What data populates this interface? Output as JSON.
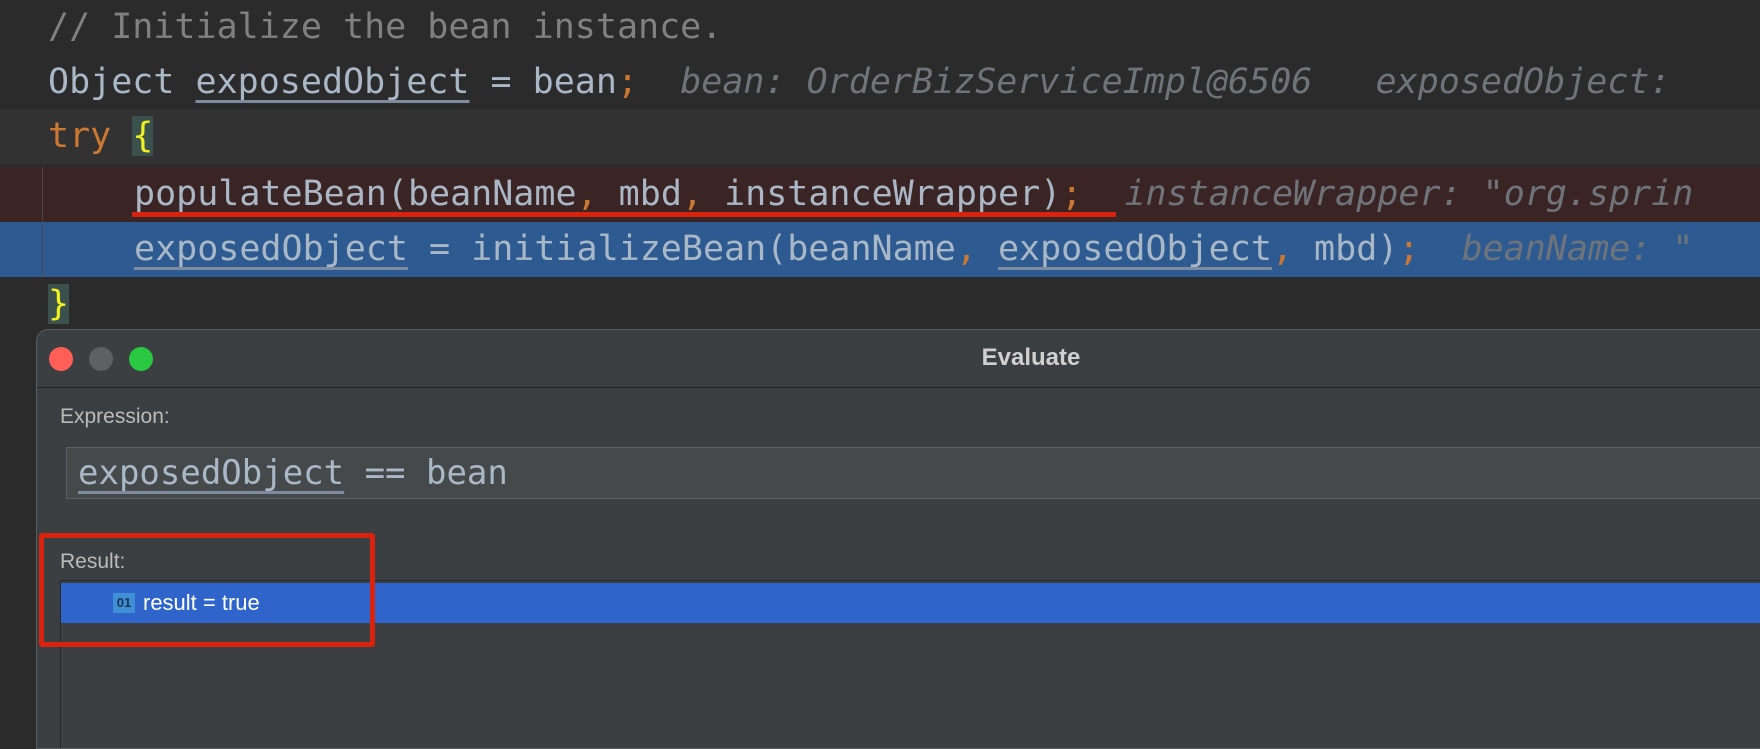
{
  "editor": {
    "lines": [
      {
        "id": "row-comment",
        "indent": 0,
        "tokens": [
          {
            "t": "// Initialize the bean instance.",
            "c": "t-cm"
          }
        ]
      },
      {
        "id": "row-obj",
        "indent": 0,
        "tokens": [
          {
            "t": "Object ",
            "c": ""
          },
          {
            "t": "exposedObject",
            "c": "t-u"
          },
          {
            "t": " = bean",
            "c": ""
          },
          {
            "t": ";",
            "c": "t-punc"
          },
          {
            "t": "  bean: OrderBizServiceImpl@6506   exposedObject:",
            "c": "t-hint"
          }
        ]
      },
      {
        "id": "row-try",
        "indent": 0,
        "tokens": [
          {
            "t": "try",
            "c": "t-kw"
          },
          {
            "t": " ",
            "c": ""
          },
          {
            "t": "{",
            "c": "t-br"
          }
        ]
      },
      {
        "id": "row-pop",
        "indent": 1,
        "tokens": [
          {
            "t": "populateBean",
            "c": ""
          },
          {
            "t": "(beanName",
            "c": ""
          },
          {
            "t": ",",
            "c": "t-punc"
          },
          {
            "t": " mbd",
            "c": ""
          },
          {
            "t": ",",
            "c": "t-punc"
          },
          {
            "t": " ",
            "c": ""
          },
          {
            "t": "instanceWrapper",
            "c": "t-u"
          },
          {
            "t": ")",
            "c": ""
          },
          {
            "t": ";",
            "c": "t-punc"
          },
          {
            "t": "  instanceWrapper: \"org.sprin",
            "c": "t-hint"
          }
        ]
      },
      {
        "id": "row-exp",
        "indent": 1,
        "tokens": [
          {
            "t": "exposedObject",
            "c": "t-u"
          },
          {
            "t": " = initializeBean(beanName",
            "c": ""
          },
          {
            "t": ",",
            "c": "t-punc"
          },
          {
            "t": " ",
            "c": ""
          },
          {
            "t": "exposedObject",
            "c": "t-u"
          },
          {
            "t": ",",
            "c": "t-punc"
          },
          {
            "t": " mbd)",
            "c": ""
          },
          {
            "t": ";",
            "c": "t-punc"
          },
          {
            "t": "  beanName: \"",
            "c": "t-hint"
          }
        ]
      },
      {
        "id": "row-brace",
        "indent": 0,
        "tokens": [
          {
            "t": "}",
            "c": "t-br"
          }
        ]
      }
    ]
  },
  "dialog": {
    "title": "Evaluate",
    "expression_label": "Expression:",
    "expression_var": "exposedObject",
    "expression_rest": " == bean",
    "result_label": "Result:",
    "result_badge": "01",
    "result_text": "result = true",
    "window_buttons": {
      "close": "#ff5f57",
      "minimize": "#5f6064",
      "zoom": "#28c840"
    }
  },
  "colors": {
    "annotation": "#d9230f",
    "selection": "#2f65ca",
    "execution_line": "#2d5b91",
    "error_line": "#3a2424"
  }
}
